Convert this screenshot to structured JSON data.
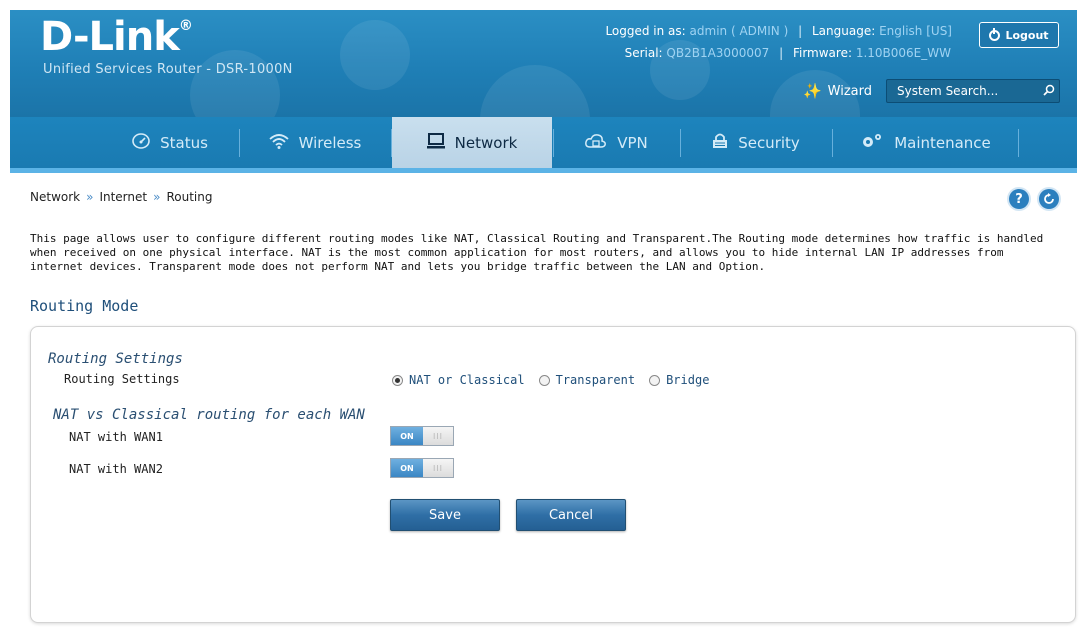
{
  "header": {
    "brand": "D-Link",
    "registered": "®",
    "subtitle": "Unified Services Router - DSR-1000N",
    "logged_in_label": "Logged in as:",
    "user": "admin ( ADMIN )",
    "language_label": "Language:",
    "language": "English [US]",
    "logout_label": "Logout",
    "serial_label": "Serial:",
    "serial": "QB2B1A3000007",
    "firmware_label": "Firmware:",
    "firmware": "1.10B006E_WW",
    "wizard_label": "Wizard",
    "search_placeholder": "System Search..."
  },
  "nav": {
    "tabs": [
      {
        "label": "Status",
        "icon": "dashboard-icon"
      },
      {
        "label": "Wireless",
        "icon": "wifi-icon"
      },
      {
        "label": "Network",
        "icon": "monitor-icon",
        "active": true
      },
      {
        "label": "VPN",
        "icon": "cloud-lock-icon"
      },
      {
        "label": "Security",
        "icon": "lock-icon"
      },
      {
        "label": "Maintenance",
        "icon": "gears-icon"
      }
    ]
  },
  "breadcrumb": [
    "Network",
    "Internet",
    "Routing"
  ],
  "description": "This page allows user to configure different routing modes like NAT, Classical Routing and Transparent.The Routing mode determines how traffic is handled when received on one physical interface. NAT is the most common application for most routers, and allows you to hide internal LAN IP addresses from internet devices. Transparent mode does not perform NAT and lets you bridge traffic between the LAN and Option.",
  "section_title": "Routing Mode",
  "form": {
    "routing_heading": "Routing Settings",
    "routing_label": "Routing Settings",
    "routing_options": [
      "NAT or Classical",
      "Transparent",
      "Bridge"
    ],
    "routing_selected": "NAT or Classical",
    "nat_heading": "NAT vs Classical routing for each WAN",
    "wan1_label": "NAT with WAN1",
    "wan2_label": "NAT with WAN2",
    "toggle_on": "ON",
    "toggle_off": "III",
    "save_label": "Save",
    "cancel_label": "Cancel"
  },
  "colors": {
    "header_blue": "#1f7fb6",
    "nav_active": "#c9dfee",
    "accent": "#2b7fbe",
    "button_blue": "#2f6fa6"
  }
}
